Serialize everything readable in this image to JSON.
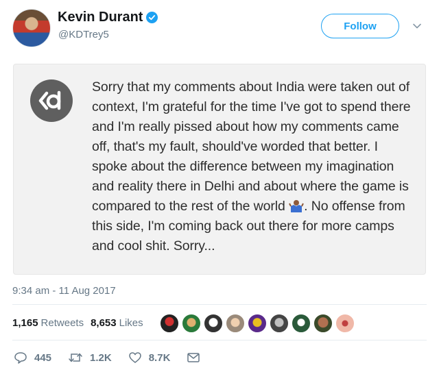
{
  "tweet": {
    "author_name": "Kevin Durant",
    "author_handle": "@KDTrey5",
    "follow_label": "Follow",
    "note_text_before_emoji": "Sorry that my comments about India were taken out of context, I'm grateful for the time I've got to spend there and I'm really pissed about how my comments came off, that's my fault, should've worded that better. I spoke about the difference between my imagination and reality there in Delhi and about where the game is compared to the rest of the world ",
    "note_text_after_emoji": ". No offense from this side, I'm coming back out there for more camps and cool shit. Sorry...",
    "timestamp": "9:34 am - 11 Aug 2017",
    "retweets_count": "1,165",
    "retweets_label": "Retweets",
    "likes_count": "8,653",
    "likes_label": "Likes",
    "replies_count": "445",
    "action_retweets": "1.2K",
    "action_likes": "8.7K"
  },
  "colors": {
    "accent": "#1da1f2",
    "muted": "#657786",
    "card_bg": "#f2f2f2"
  },
  "icons": [
    "verified-badge-icon",
    "chevron-down-icon",
    "kd-logo-icon",
    "shrug-emoji-icon",
    "reply-icon",
    "retweet-icon",
    "like-icon",
    "message-icon"
  ]
}
